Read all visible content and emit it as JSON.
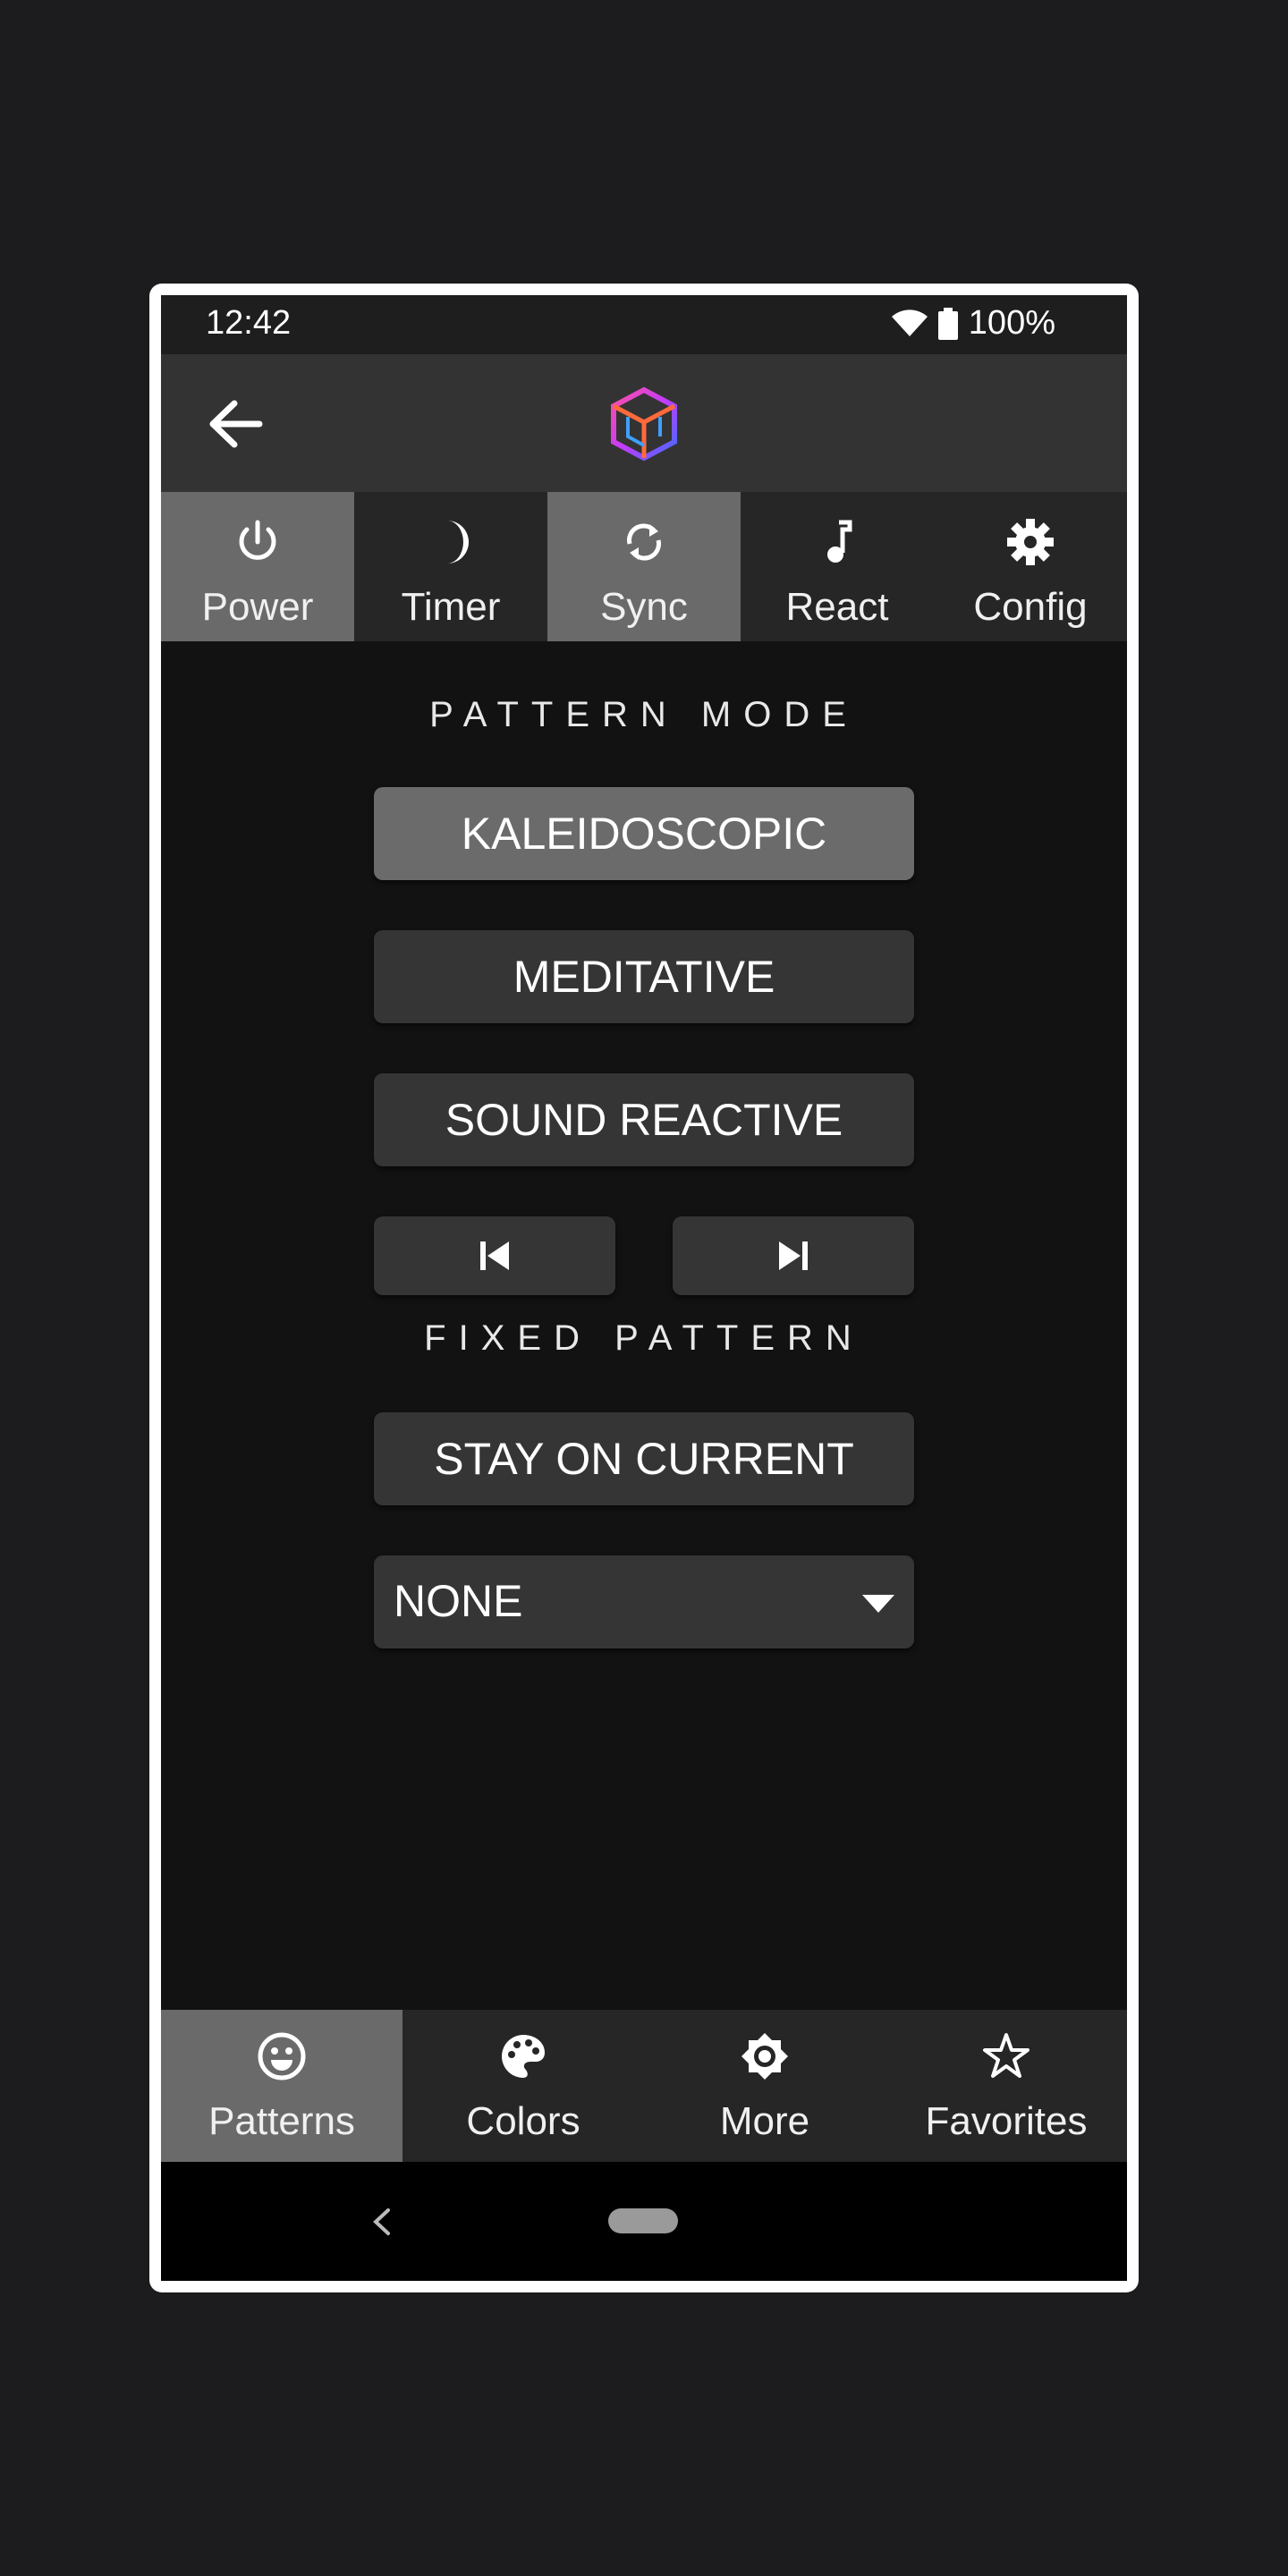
{
  "status_bar": {
    "time": "12:42",
    "battery": "100%"
  },
  "tabs": [
    {
      "label": "Power",
      "icon": "power-icon",
      "active": true
    },
    {
      "label": "Timer",
      "icon": "moon-icon",
      "active": false
    },
    {
      "label": "Sync",
      "icon": "sync-icon",
      "active": true
    },
    {
      "label": "React",
      "icon": "music-note-icon",
      "active": false
    },
    {
      "label": "Config",
      "icon": "gear-icon",
      "active": false
    }
  ],
  "main": {
    "pattern_mode_label": "PATTERN  MODE",
    "modes": [
      {
        "label": "KALEIDOSCOPIC",
        "active": true
      },
      {
        "label": "MEDITATIVE",
        "active": false
      },
      {
        "label": "SOUND REACTIVE",
        "active": false
      }
    ],
    "fixed_pattern_label": "FIXED  PATTERN",
    "stay_on_current_label": "STAY ON CURRENT",
    "pattern_select_value": "NONE"
  },
  "bottom_nav": [
    {
      "label": "Patterns",
      "icon": "smiley-icon",
      "active": true
    },
    {
      "label": "Colors",
      "icon": "palette-icon",
      "active": false
    },
    {
      "label": "More",
      "icon": "brightness-icon",
      "active": false
    },
    {
      "label": "Favorites",
      "icon": "star-icon",
      "active": false
    }
  ],
  "colors": {
    "background": "#1c1c1e",
    "surface": "#353535",
    "active": "#6b6b6b",
    "appbar": "#333333"
  }
}
